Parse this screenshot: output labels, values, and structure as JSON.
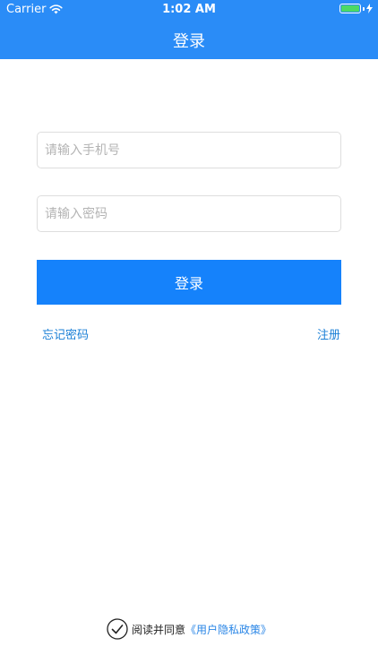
{
  "status_bar": {
    "carrier": "Carrier",
    "time": "1:02 AM",
    "wifi_icon": "wifi-icon",
    "battery_icon": "battery-icon",
    "battery_level": 1.0
  },
  "header": {
    "title": "登录",
    "background": "#2a8cf7"
  },
  "form": {
    "phone_placeholder": "请输入手机号",
    "phone_value": "",
    "password_placeholder": "请输入密码",
    "password_value": "",
    "login_label": "登录",
    "login_color": "#1582fb"
  },
  "links": {
    "forgot": "忘记密码",
    "register": "注册",
    "link_color": "#1a7fd6"
  },
  "agreement": {
    "checkbox_icon": "checkmark-circle-icon",
    "text": "阅读并同意",
    "policy": "《用户隐私政策》"
  }
}
